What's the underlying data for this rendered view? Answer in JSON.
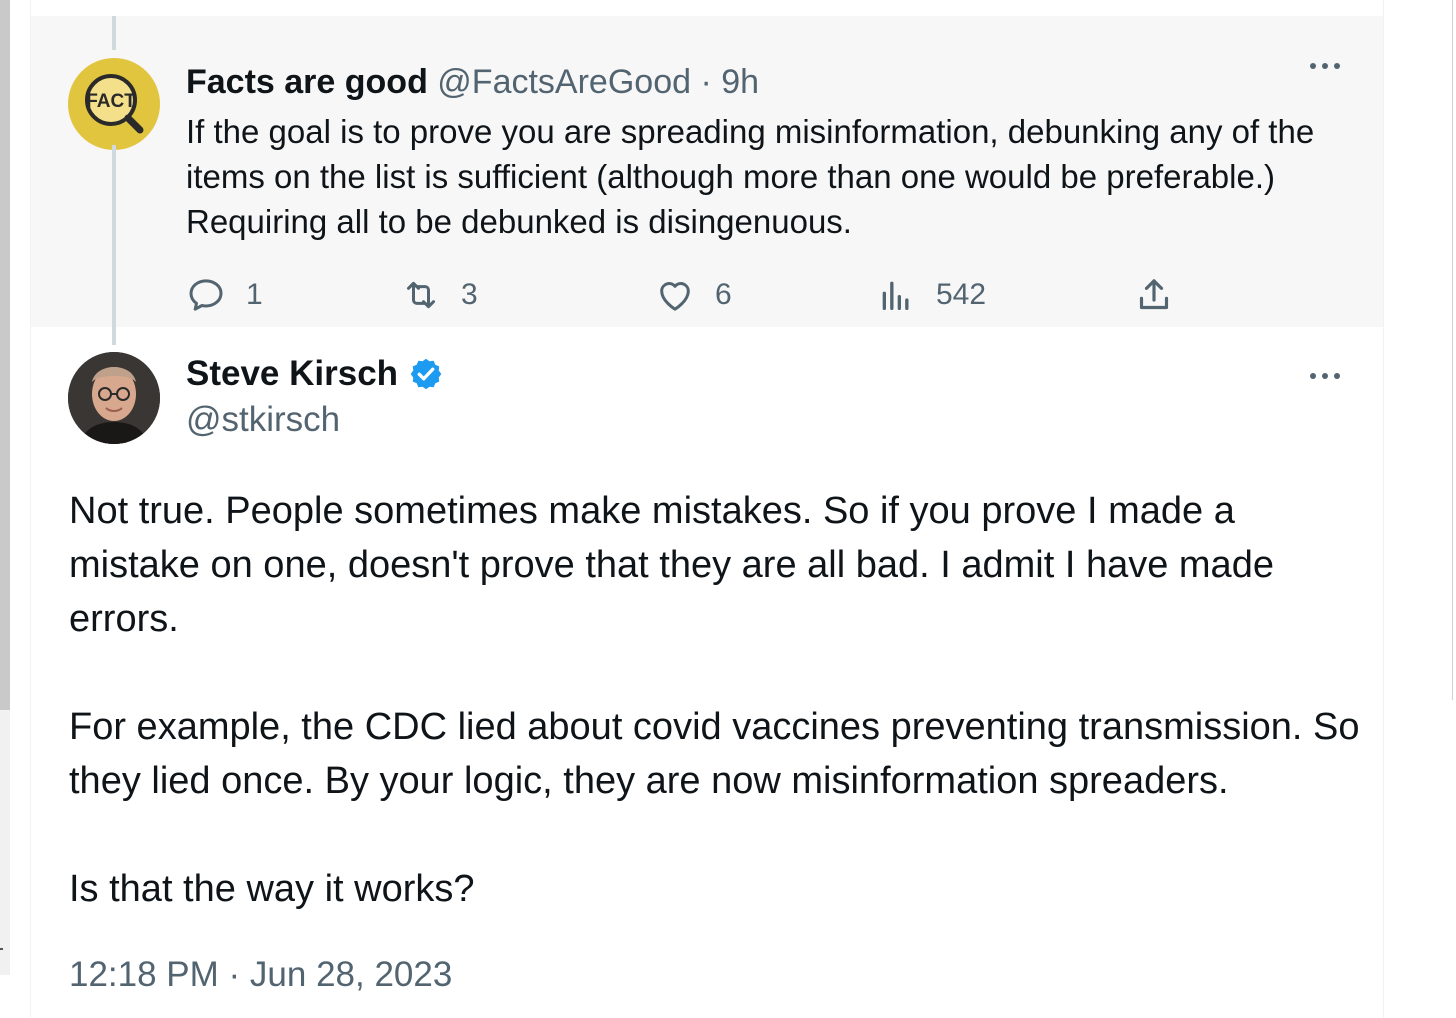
{
  "reply": {
    "name": "Facts are good",
    "handle": "@FactsAreGood",
    "separator": "·",
    "time": "9h",
    "avatar_text": "FACT",
    "text": "If the goal is to prove you are spreading misinformation, debunking any of the items on the list is sufficient (although more than one would be preferable.) Requiring all to be debunked is disingenuous.",
    "actions": {
      "replies": "1",
      "retweets": "3",
      "likes": "6",
      "views": "542"
    }
  },
  "main_tweet": {
    "name": "Steve Kirsch",
    "handle": "@stkirsch",
    "verified": true,
    "paragraphs": [
      "Not true. People sometimes make mistakes. So if you prove I made a mistake on one, doesn't prove that they are all bad. I admit I have made errors.",
      "For example, the CDC lied about covid vaccines preventing transmission. So they lied once. By your logic, they are now misinformation spreaders.",
      "Is that the way it works?"
    ],
    "timestamp": "12:18 PM · Jun 28, 2023"
  },
  "colors": {
    "text_primary": "#0f1419",
    "text_secondary": "#536471",
    "verified_badge": "#1d9bf0",
    "reply_bg": "#f7f7f7",
    "fact_badge": "#e2c53f"
  },
  "icons": [
    "more-icon",
    "reply-icon",
    "retweet-icon",
    "like-icon",
    "views-icon",
    "share-icon",
    "verified-badge-icon"
  ]
}
